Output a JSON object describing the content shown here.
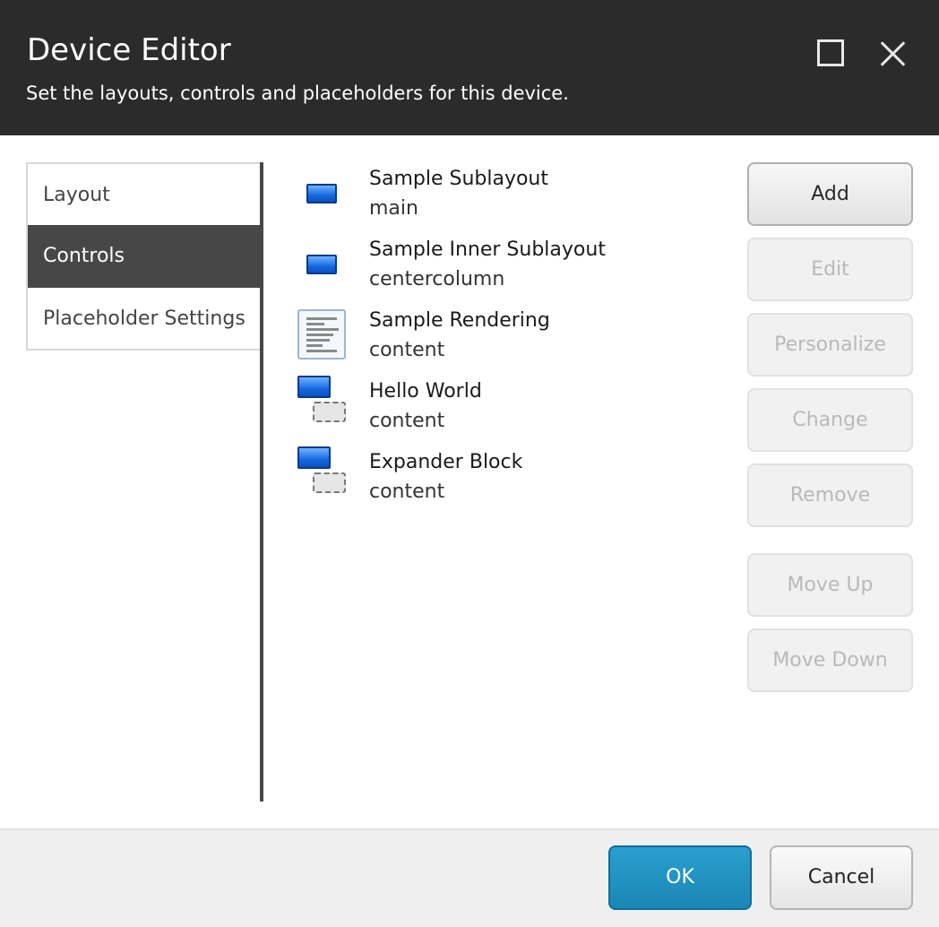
{
  "header": {
    "title": "Device Editor",
    "subtitle": "Set the layouts, controls and placeholders for this device.",
    "maximize_icon": "maximize-icon",
    "close_icon": "close-icon",
    "background": "#2b2b2b"
  },
  "nav": {
    "items": [
      {
        "label": "Layout",
        "active": false
      },
      {
        "label": "Controls",
        "active": true
      },
      {
        "label": "Placeholder Settings",
        "active": false
      }
    ]
  },
  "controls": [
    {
      "name": "Sample Sublayout",
      "placeholder": "main",
      "icon": "sublayout-icon"
    },
    {
      "name": "Sample Inner Sublayout",
      "placeholder": "centercolumn",
      "icon": "sublayout-icon"
    },
    {
      "name": "Sample Rendering",
      "placeholder": "content",
      "icon": "rendering-icon"
    },
    {
      "name": "Hello World",
      "placeholder": "content",
      "icon": "compound-control-icon"
    },
    {
      "name": "Expander Block",
      "placeholder": "content",
      "icon": "compound-control-icon"
    }
  ],
  "actions": {
    "add": "Add",
    "edit": "Edit",
    "personalize": "Personalize",
    "change": "Change",
    "remove": "Remove",
    "move_up": "Move Up",
    "move_down": "Move Down"
  },
  "footer": {
    "ok": "OK",
    "cancel": "Cancel",
    "ok_color": "#1a86b5"
  }
}
